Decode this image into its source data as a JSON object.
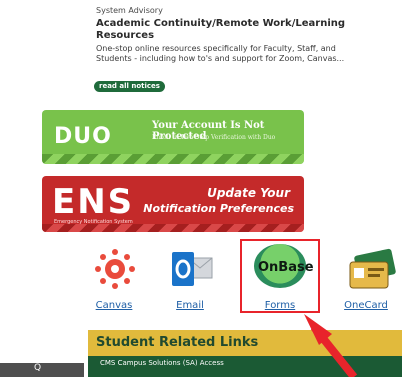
{
  "advisory": {
    "kicker": "System Advisory",
    "title_line1": "Academic Continuity/Remote Work/Learning",
    "title_line2": "Resources",
    "body_line1": "One-stop online resources specifically for Faculty, Staff, and",
    "body_line2": "Students - including how to's and support for Zoom, Canvas..."
  },
  "read_all": "read all notices",
  "duo": {
    "logo": "DUO",
    "title": "Your Account Is Not Protected",
    "subtitle": "Enroll In Two-Step Verification with Duo"
  },
  "ens": {
    "logo": "ENS",
    "small": "Emergency Notification System",
    "line1": "Update Your",
    "line2": "Notification Preferences"
  },
  "apps": [
    {
      "label": "Canvas",
      "icon": "canvas-icon"
    },
    {
      "label": "Email",
      "icon": "outlook-email-icon"
    },
    {
      "label": "Forms",
      "icon": "onbase-icon",
      "icon_text": "OnBase"
    },
    {
      "label": "OneCard",
      "icon": "onecard-icon"
    }
  ],
  "student_links": {
    "header": "Student Related Links",
    "first_item": "CMS Campus Solutions (SA) Access"
  },
  "bottom_tab": "Q",
  "colors": {
    "duo_green": "#79c24b",
    "ens_red": "#c42a2a",
    "link_blue": "#1f5fa6",
    "gold": "#e1ba3c",
    "dark_green": "#1b5a34",
    "highlight_red": "#e8242b"
  }
}
